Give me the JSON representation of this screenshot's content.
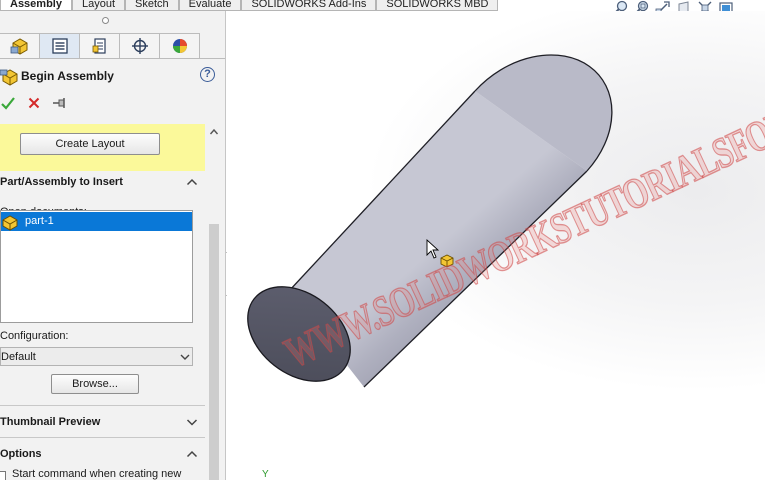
{
  "command_tabs": [
    {
      "label": "Assembly",
      "active": true
    },
    {
      "label": "Layout",
      "active": false
    },
    {
      "label": "Sketch",
      "active": false
    },
    {
      "label": "Evaluate",
      "active": false
    },
    {
      "label": "SOLIDWORKS Add-Ins",
      "active": false
    },
    {
      "label": "SOLIDWORKS MBD",
      "active": false
    }
  ],
  "heads_up_toolbar": [
    "zoom-to-fit-icon",
    "zoom-to-area-icon",
    "previous-view-icon",
    "section-view-icon",
    "view-orientation-icon",
    "display-style-icon"
  ],
  "manager_tabs": [
    "feature-manager-icon",
    "property-manager-icon",
    "configuration-manager-icon",
    "dimxpert-manager-icon",
    "display-manager-icon"
  ],
  "property_manager": {
    "title": "Begin Assembly",
    "help": "?",
    "message_button": "Create Layout",
    "part_group": {
      "title": "Part/Assembly to Insert",
      "open_documents_label": "Open documents:",
      "documents": [
        {
          "name": "part-1",
          "selected": true
        }
      ],
      "configuration_label": "Configuration:",
      "configuration_value": "Default",
      "browse_button": "Browse..."
    },
    "thumbnail_group": {
      "title": "Thumbnail Preview"
    },
    "options_group": {
      "title": "Options",
      "start_command_label": "Start command when creating new",
      "start_command_checked": false
    }
  },
  "viewport": {
    "watermark": "WWW.SOLIDWORKSTUTORIALSFORBEGINNERS.COM",
    "triad_y_label": "Y",
    "cylinder_color": "#a8a9b8",
    "watermark_color": "#e07a78"
  },
  "colors": {
    "selection": "#0a78d7",
    "message_bg": "#fbf99a",
    "panel_bg": "#f2f2f2",
    "accept": "#3aa83a",
    "cancel": "#d42a2a"
  }
}
